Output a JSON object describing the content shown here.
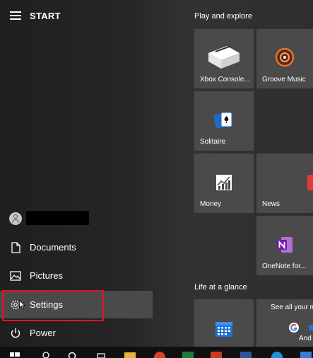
{
  "start_menu": {
    "title": "START",
    "user_redacted": true,
    "left_items": [
      {
        "label": "Documents",
        "icon": "document-icon"
      },
      {
        "label": "Pictures",
        "icon": "pictures-icon"
      },
      {
        "label": "Settings",
        "icon": "gear-icon"
      },
      {
        "label": "Power",
        "icon": "power-icon"
      }
    ]
  },
  "groups": {
    "play_and_explore": "Play and explore",
    "life_at_a_glance": "Life at a glance"
  },
  "tiles": {
    "xbox": "Xbox Console...",
    "groove": "Groove Music",
    "solitaire": "Solitaire",
    "money": "Money",
    "news": "News",
    "onenote": "OneNote for...",
    "see_all": "See all your m",
    "and": "And"
  },
  "colors": {
    "highlight_border": "#e81123",
    "tile_bg": "#4a4a4a",
    "onenote_purple": "#7719aa",
    "calendar_blue": "#1e73d2"
  }
}
